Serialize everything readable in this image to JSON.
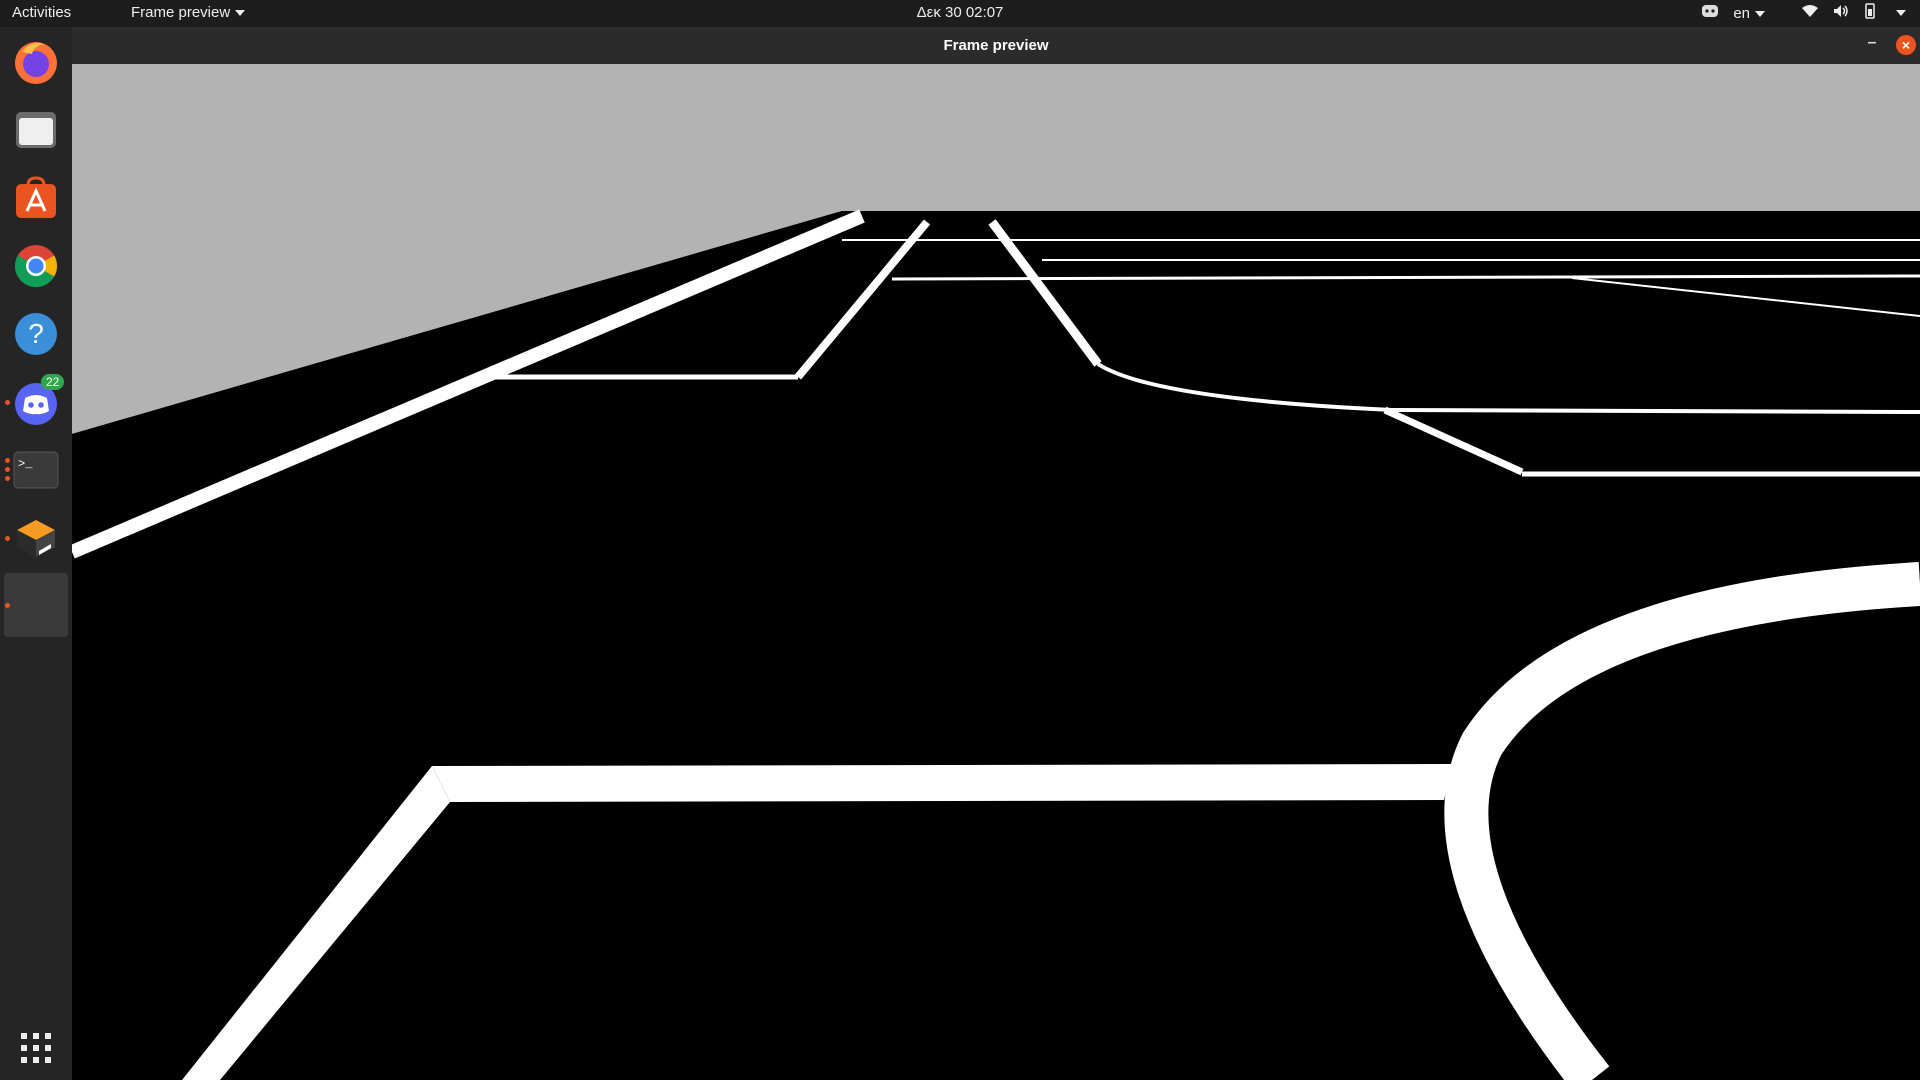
{
  "topbar": {
    "activities": "Activities",
    "app_menu": "Frame preview",
    "clock": "Δεκ 30  02:07",
    "language": "en"
  },
  "dock": {
    "items": [
      {
        "name": "firefox-icon"
      },
      {
        "name": "files-icon"
      },
      {
        "name": "software-store-icon"
      },
      {
        "name": "chrome-icon"
      },
      {
        "name": "help-icon"
      },
      {
        "name": "discord-icon",
        "badge": "22"
      },
      {
        "name": "terminal-icon"
      },
      {
        "name": "simulator-icon"
      },
      {
        "name": "frame-preview-icon"
      }
    ],
    "show_apps": "app-grid-icon"
  },
  "window": {
    "title": "Frame preview"
  },
  "colors": {
    "accent": "#e95420",
    "sky": "#b3b3b3",
    "floor": "#000000",
    "lines": "#ffffff"
  }
}
